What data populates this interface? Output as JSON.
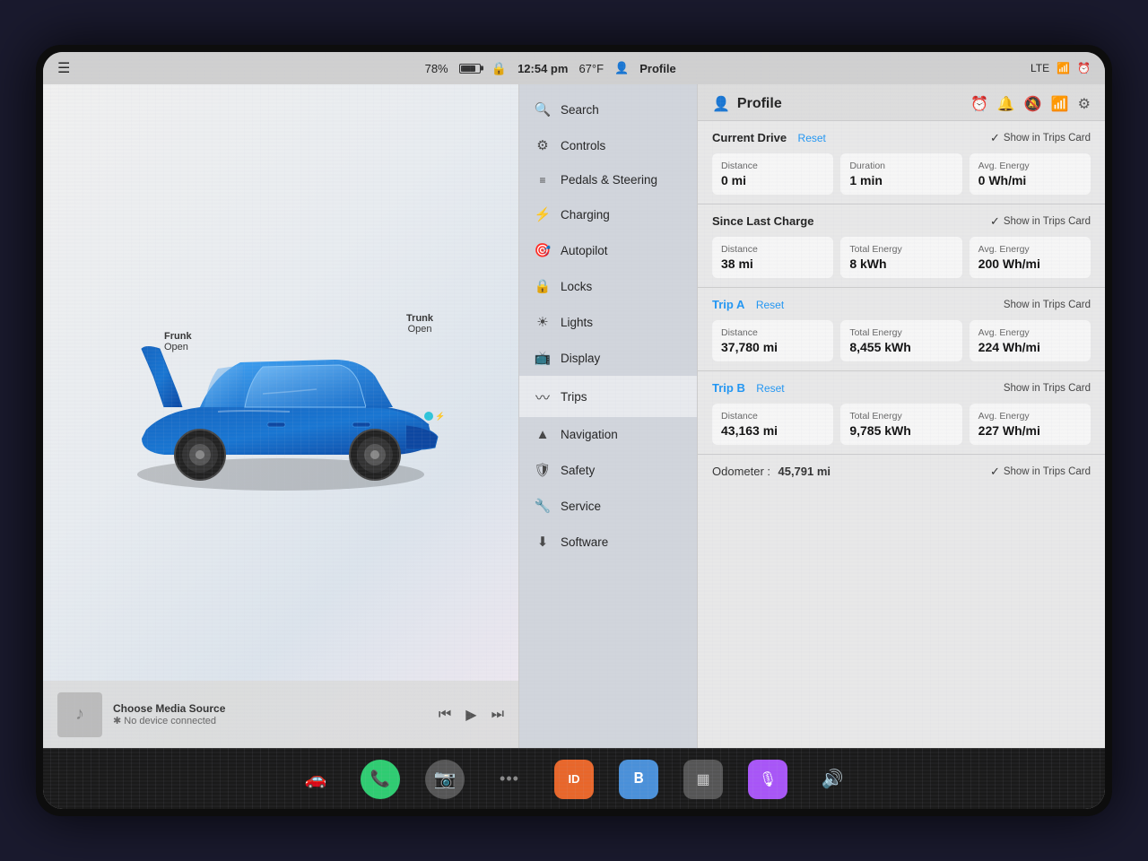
{
  "statusBar": {
    "battery": "78%",
    "time": "12:54 pm",
    "temperature": "67°F",
    "profile": "Profile",
    "network": "LTE"
  },
  "carPanel": {
    "frunk": {
      "label": "Frunk",
      "status": "Open"
    },
    "trunk": {
      "label": "Trunk",
      "status": "Open"
    },
    "media": {
      "title": "Choose Media Source",
      "subtitle": "✱ No device connected",
      "icon": "♪"
    }
  },
  "menu": {
    "items": [
      {
        "icon": "🔍",
        "label": "Search",
        "id": "search"
      },
      {
        "icon": "⚙",
        "label": "Controls",
        "id": "controls"
      },
      {
        "icon": "≡",
        "label": "Pedals & Steering",
        "id": "pedals"
      },
      {
        "icon": "⚡",
        "label": "Charging",
        "id": "charging"
      },
      {
        "icon": "🎯",
        "label": "Autopilot",
        "id": "autopilot"
      },
      {
        "icon": "🔒",
        "label": "Locks",
        "id": "locks"
      },
      {
        "icon": "☀",
        "label": "Lights",
        "id": "lights"
      },
      {
        "icon": "📺",
        "label": "Display",
        "id": "display"
      },
      {
        "icon": "〰",
        "label": "Trips",
        "id": "trips",
        "active": true
      },
      {
        "icon": "▲",
        "label": "Navigation",
        "id": "navigation"
      },
      {
        "icon": "🛡",
        "label": "Safety",
        "id": "safety"
      },
      {
        "icon": "🔧",
        "label": "Service",
        "id": "service"
      },
      {
        "icon": "⬇",
        "label": "Software",
        "id": "software"
      }
    ]
  },
  "rightPanel": {
    "title": "Profile",
    "sections": {
      "currentDrive": {
        "title": "Current Drive",
        "resetLabel": "Reset",
        "showTripsCard": "Show in Trips Card",
        "showTripsChecked": true,
        "distance": {
          "label": "Distance",
          "value": "0 mi"
        },
        "duration": {
          "label": "Duration",
          "value": "1 min"
        },
        "avgEnergy": {
          "label": "Avg. Energy",
          "value": "0 Wh/mi"
        }
      },
      "sinceLastCharge": {
        "title": "Since Last Charge",
        "showTripsCard": "Show in Trips Card",
        "showTripsChecked": true,
        "distance": {
          "label": "Distance",
          "value": "38 mi"
        },
        "totalEnergy": {
          "label": "Total Energy",
          "value": "8 kWh"
        },
        "avgEnergy": {
          "label": "Avg. Energy",
          "value": "200 Wh/mi"
        }
      },
      "tripA": {
        "title": "Trip A",
        "resetLabel": "Reset",
        "showTripsCard": "Show in Trips Card",
        "showTripsChecked": false,
        "distance": {
          "label": "Distance",
          "value": "37,780 mi"
        },
        "totalEnergy": {
          "label": "Total Energy",
          "value": "8,455 kWh"
        },
        "avgEnergy": {
          "label": "Avg. Energy",
          "value": "224 Wh/mi"
        }
      },
      "tripB": {
        "title": "Trip B",
        "resetLabel": "Reset",
        "showTripsCard": "Show in Trips Card",
        "showTripsChecked": false,
        "distance": {
          "label": "Distance",
          "value": "43,163 mi"
        },
        "totalEnergy": {
          "label": "Total Energy",
          "value": "9,785 kWh"
        },
        "avgEnergy": {
          "label": "Avg. Energy",
          "value": "227 Wh/mi"
        }
      },
      "odometer": {
        "label": "Odometer :",
        "value": "45,791 mi",
        "showTripsCard": "Show in Trips Card",
        "showTripsChecked": true
      }
    }
  },
  "dock": {
    "items": [
      {
        "icon": "🚗",
        "label": "car",
        "color": "transparent"
      },
      {
        "icon": "📞",
        "label": "phone",
        "color": "#2ecc71"
      },
      {
        "icon": "📷",
        "label": "camera",
        "color": "#555"
      },
      {
        "icon": "•••",
        "label": "more",
        "color": "transparent"
      },
      {
        "icon": "ID",
        "label": "id-card",
        "color": "#ff6b35"
      },
      {
        "icon": "𝔅",
        "label": "bluetooth",
        "color": "#4a90d9"
      },
      {
        "icon": "▦",
        "label": "grid",
        "color": "#555"
      },
      {
        "icon": "🎙",
        "label": "podcast",
        "color": "#a855f7"
      },
      {
        "icon": "🔊",
        "label": "volume",
        "color": "transparent"
      }
    ]
  }
}
